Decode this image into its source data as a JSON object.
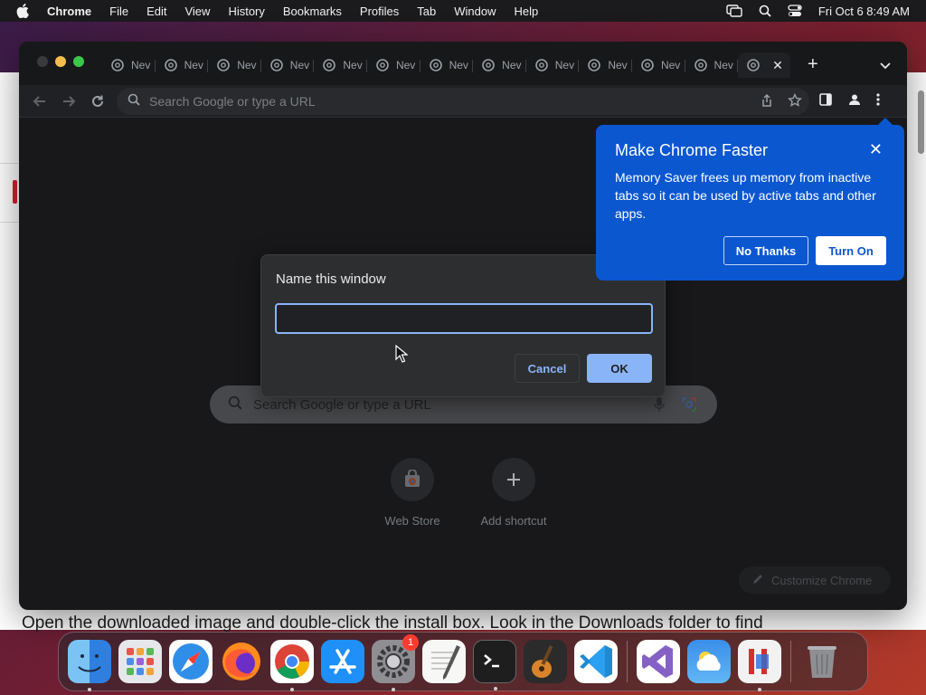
{
  "menubar": {
    "items": [
      "Chrome",
      "File",
      "Edit",
      "View",
      "History",
      "Bookmarks",
      "Profiles",
      "Tab",
      "Window",
      "Help"
    ],
    "clock": "Fri Oct 6  8:49 AM"
  },
  "background_page": {
    "text": "Open the downloaded image and double-click the install box. Look in the Downloads folder to find"
  },
  "tabs": {
    "label": "New Tab",
    "short_label": "Nev",
    "count": 13,
    "active_index": 12
  },
  "toolbar": {
    "omnibox_placeholder": "Search Google or type a URL"
  },
  "ntp": {
    "search_placeholder": "Search Google or type a URL",
    "shortcuts": [
      {
        "label": "Web Store"
      },
      {
        "label": "Add shortcut"
      }
    ],
    "customize_label": "Customize Chrome"
  },
  "dialog": {
    "title": "Name this window",
    "input_value": "",
    "cancel_label": "Cancel",
    "ok_label": "OK"
  },
  "bubble": {
    "title": "Make Chrome Faster",
    "body": "Memory Saver frees up memory from inactive tabs so it can be used by active tabs and other apps.",
    "no_thanks_label": "No Thanks",
    "turn_on_label": "Turn On",
    "close_glyph": "✕"
  },
  "dock": {
    "apps": [
      "Finder",
      "Launchpad",
      "Safari",
      "Firefox",
      "Chrome",
      "App Store",
      "System Settings",
      "TextEdit",
      "Terminal",
      "GarageBand",
      "VS Code",
      "Visual Studio",
      "Weather",
      "Parallels",
      "Trash"
    ],
    "settings_badge": "1"
  },
  "colors": {
    "bubble_blue": "#0b57d0",
    "accent_blue": "#8ab4f8",
    "chrome_dark": "#202124"
  }
}
